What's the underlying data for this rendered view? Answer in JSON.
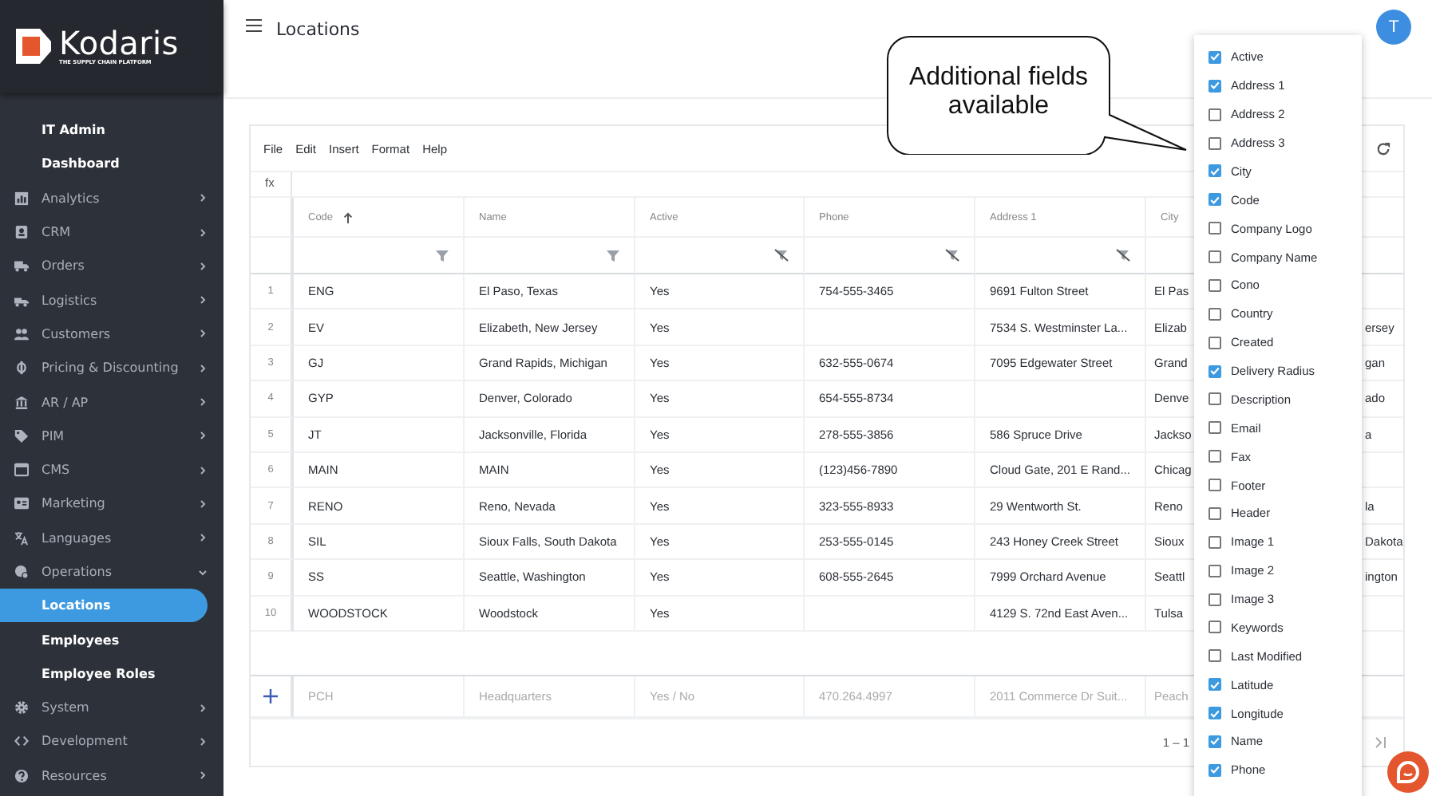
{
  "sidebar": {
    "logo": {
      "name": "Kodaris",
      "tagline": "THE SUPPLY CHAIN PLATFORM"
    },
    "items": [
      {
        "kind": "link",
        "label": "IT Admin",
        "selected": false
      },
      {
        "kind": "link",
        "label": "Dashboard",
        "selected": false
      },
      {
        "kind": "section",
        "label": "Analytics",
        "expanded": false
      },
      {
        "kind": "section",
        "label": "CRM",
        "expanded": false
      },
      {
        "kind": "section",
        "label": "Orders",
        "expanded": false
      },
      {
        "kind": "section",
        "label": "Logistics",
        "expanded": false
      },
      {
        "kind": "section",
        "label": "Customers",
        "expanded": false
      },
      {
        "kind": "section",
        "label": "Pricing & Discounting",
        "expanded": false
      },
      {
        "kind": "section",
        "label": "AR / AP",
        "expanded": false
      },
      {
        "kind": "section",
        "label": "PIM",
        "expanded": false
      },
      {
        "kind": "section",
        "label": "CMS",
        "expanded": false
      },
      {
        "kind": "section",
        "label": "Marketing",
        "expanded": false
      },
      {
        "kind": "section",
        "label": "Languages",
        "expanded": false
      },
      {
        "kind": "section",
        "label": "Operations",
        "expanded": true,
        "children": [
          {
            "kind": "link",
            "label": "Locations",
            "selected": true
          },
          {
            "kind": "link",
            "label": "Employees",
            "selected": false
          },
          {
            "kind": "link",
            "label": "Employee Roles",
            "selected": false
          }
        ]
      },
      {
        "kind": "section",
        "label": "System",
        "expanded": false
      },
      {
        "kind": "section",
        "label": "Development",
        "expanded": false
      },
      {
        "kind": "section",
        "label": "Resources",
        "expanded": false
      }
    ]
  },
  "header": {
    "title": "Locations",
    "avatar": "T"
  },
  "grid": {
    "menu": [
      "File",
      "Edit",
      "Insert",
      "Format",
      "Help"
    ],
    "formula_label": "fx",
    "columns": [
      {
        "label": "Code",
        "sorted": true,
        "kind": "funnel"
      },
      {
        "label": "Name",
        "sorted": false,
        "kind": "funnel"
      },
      {
        "label": "Active",
        "sorted": false,
        "kind": "clear"
      },
      {
        "label": "Phone",
        "sorted": false,
        "kind": "clear"
      },
      {
        "label": "Address 1",
        "sorted": false,
        "kind": "clear"
      },
      {
        "label": "City",
        "sorted": false,
        "kind": "plain"
      }
    ],
    "rows": [
      {
        "number": "1",
        "code": "ENG",
        "name": "El Paso, Texas",
        "active": "Yes",
        "phone": "754-555-3465",
        "address_1": "9691 Fulton Street",
        "city": "El Pas"
      },
      {
        "number": "2",
        "code": "EV",
        "name": "Elizabeth, New Jersey",
        "active": "Yes",
        "address_1": "7534 S. Westminster La...",
        "city": "Elizab",
        "column_8": "ersey"
      },
      {
        "number": "3",
        "code": "GJ",
        "name": "Grand Rapids, Michigan",
        "active": "Yes",
        "phone": "632-555-0674",
        "address_1": "7095 Edgewater Street",
        "city": "Grand",
        "column_8": "gan"
      },
      {
        "number": "4",
        "code": "GYP",
        "name": "Denver, Colorado",
        "active": "Yes",
        "phone": "654-555-8734",
        "city": "Denve",
        "column_8": "ado"
      },
      {
        "number": "5",
        "code": "JT",
        "name": "Jacksonville, Florida",
        "active": "Yes",
        "phone": "278-555-3856",
        "address_1": "586 Spruce Drive",
        "city": "Jackso",
        "column_8": "a"
      },
      {
        "number": "6",
        "code": "MAIN",
        "name": "MAIN",
        "active": "Yes",
        "phone": "(123)456-7890",
        "address_1": "Cloud Gate, 201 E Rand...",
        "city": "Chicag"
      },
      {
        "number": "7",
        "code": "RENO",
        "name": "Reno, Nevada",
        "active": "Yes",
        "phone": "323-555-8933",
        "address_1": "29 Wentworth St.",
        "city": "Reno",
        "column_8": "la"
      },
      {
        "number": "8",
        "code": "SIL",
        "name": "Sioux Falls, South Dakota",
        "active": "Yes",
        "phone": "253-555-0145",
        "address_1": "243 Honey Creek Street",
        "city": "Sioux",
        "column_8": "Dakota"
      },
      {
        "number": "9",
        "code": "SS",
        "name": "Seattle, Washington",
        "active": "Yes",
        "phone": "608-555-2645",
        "address_1": "7999 Orchard Avenue",
        "city": "Seattl",
        "column_8": "ington"
      },
      {
        "number": "10",
        "code": "WOODSTOCK",
        "name": "Woodstock",
        "active": "Yes",
        "address_1": "4129 S. 72nd East Aven...",
        "city": "Tulsa"
      }
    ],
    "new_row": {
      "code": "PCH",
      "name": "Headquarters",
      "active": "Yes / No",
      "phone": "470.264.4997",
      "address_1": "2011 Commerce Dr Suit...",
      "city": "Peach"
    },
    "pagination": "1 – 1"
  },
  "column_menu": [
    {
      "label": "Active",
      "checked": true
    },
    {
      "label": "Address 1",
      "checked": true
    },
    {
      "label": "Address 2",
      "checked": false
    },
    {
      "label": "Address 3",
      "checked": false
    },
    {
      "label": "City",
      "checked": true
    },
    {
      "label": "Code",
      "checked": true
    },
    {
      "label": "Company Logo",
      "checked": false
    },
    {
      "label": "Company Name",
      "checked": false
    },
    {
      "label": "Cono",
      "checked": false
    },
    {
      "label": "Country",
      "checked": false
    },
    {
      "label": "Created",
      "checked": false
    },
    {
      "label": "Delivery Radius",
      "checked": true
    },
    {
      "label": "Description",
      "checked": false
    },
    {
      "label": "Email",
      "checked": false
    },
    {
      "label": "Fax",
      "checked": false
    },
    {
      "label": "Footer",
      "checked": false
    },
    {
      "label": "Header",
      "checked": false
    },
    {
      "label": "Image 1",
      "checked": false
    },
    {
      "label": "Image 2",
      "checked": false
    },
    {
      "label": "Image 3",
      "checked": false
    },
    {
      "label": "Keywords",
      "checked": false
    },
    {
      "label": "Last Modified",
      "checked": false
    },
    {
      "label": "Latitude",
      "checked": true
    },
    {
      "label": "Longitude",
      "checked": true
    },
    {
      "label": "Name",
      "checked": true
    },
    {
      "label": "Phone",
      "checked": true
    }
  ],
  "callout": {
    "text": "Additional fields available"
  }
}
